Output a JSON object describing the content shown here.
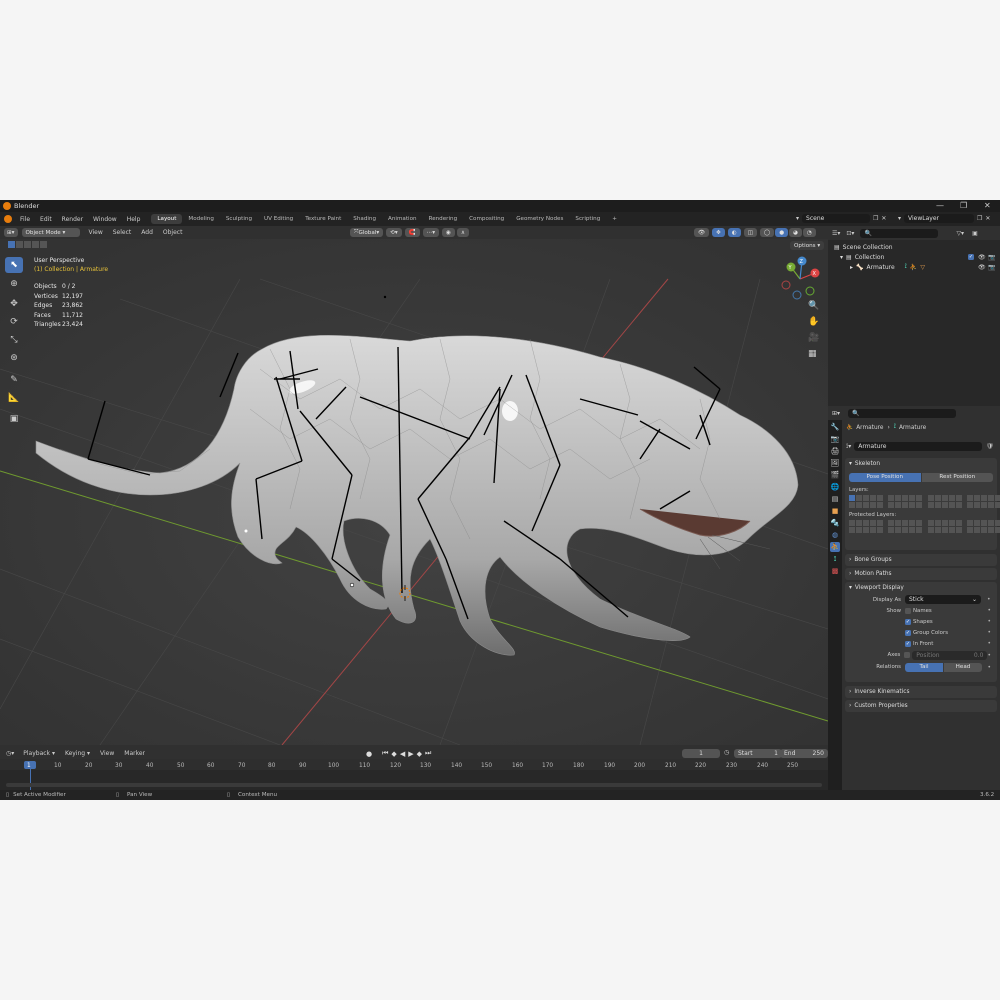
{
  "titlebar": {
    "title": "Blender",
    "minimize": "—",
    "maximize": "❐",
    "close": "✕"
  },
  "menu": [
    "File",
    "Edit",
    "Render",
    "Window",
    "Help"
  ],
  "workspaces": [
    "Layout",
    "Modeling",
    "Sculpting",
    "UV Editing",
    "Texture Paint",
    "Shading",
    "Animation",
    "Rendering",
    "Compositing",
    "Geometry Nodes",
    "Scripting"
  ],
  "workspace_add": "+",
  "scene": "Scene",
  "view_layer": "ViewLayer",
  "viewport_header": {
    "mode": "Object Mode",
    "menus": [
      "View",
      "Select",
      "Add",
      "Object"
    ],
    "transform_orientation": "Global",
    "options": "Options"
  },
  "viewport": {
    "view_name": "User Perspective",
    "collection_line": "(1) Collection | Armature",
    "stats": [
      {
        "label": "Objects",
        "value": "0 / 2"
      },
      {
        "label": "Vertices",
        "value": "12,197"
      },
      {
        "label": "Edges",
        "value": "23,862"
      },
      {
        "label": "Faces",
        "value": "11,712"
      },
      {
        "label": "Triangles",
        "value": "23,424"
      }
    ],
    "gizmo": {
      "x": "X",
      "y": "Y",
      "z": "Z"
    }
  },
  "outliner": {
    "scene_collection": "Scene Collection",
    "collection": "Collection",
    "armature": "Armature"
  },
  "properties": {
    "breadcrumb_object": "Armature",
    "breadcrumb_data": "Armature",
    "data_name": "Armature",
    "skeleton": {
      "title": "Skeleton",
      "pose_position": "Pose Position",
      "rest_position": "Rest Position",
      "layers_label": "Layers:",
      "protected_layers_label": "Protected Layers:"
    },
    "bone_groups": "Bone Groups",
    "motion_paths": "Motion Paths",
    "viewport_display": {
      "title": "Viewport Display",
      "display_as_label": "Display As",
      "display_as_value": "Stick",
      "show_label": "Show",
      "names": "Names",
      "shapes": "Shapes",
      "group_colors": "Group Colors",
      "in_front": "In Front",
      "axes_label": "Axes",
      "position_label": "Position",
      "position_value": "0.0",
      "relations_label": "Relations",
      "tail": "Tail",
      "head": "Head"
    },
    "inverse_kinematics": "Inverse Kinematics",
    "custom_properties": "Custom Properties"
  },
  "timeline": {
    "menus": [
      "Playback",
      "Keying",
      "View",
      "Marker"
    ],
    "current_frame": "1",
    "start_label": "Start",
    "start_value": "1",
    "end_label": "End",
    "end_value": "250",
    "ticks": [
      "1",
      "10",
      "20",
      "30",
      "40",
      "50",
      "60",
      "70",
      "80",
      "90",
      "100",
      "110",
      "120",
      "130",
      "140",
      "150",
      "160",
      "170",
      "180",
      "190",
      "200",
      "210",
      "220",
      "230",
      "240",
      "250"
    ]
  },
  "statusbar": {
    "left": "Set Active Modifier",
    "middle": "Pan View",
    "right": "Context Menu",
    "version": "3.6.2"
  },
  "colors": {
    "accent": "#4772b3",
    "grid_x_axis": "#a34646",
    "grid_y_axis": "#6f9a2f",
    "orange": "#e87d0d"
  }
}
